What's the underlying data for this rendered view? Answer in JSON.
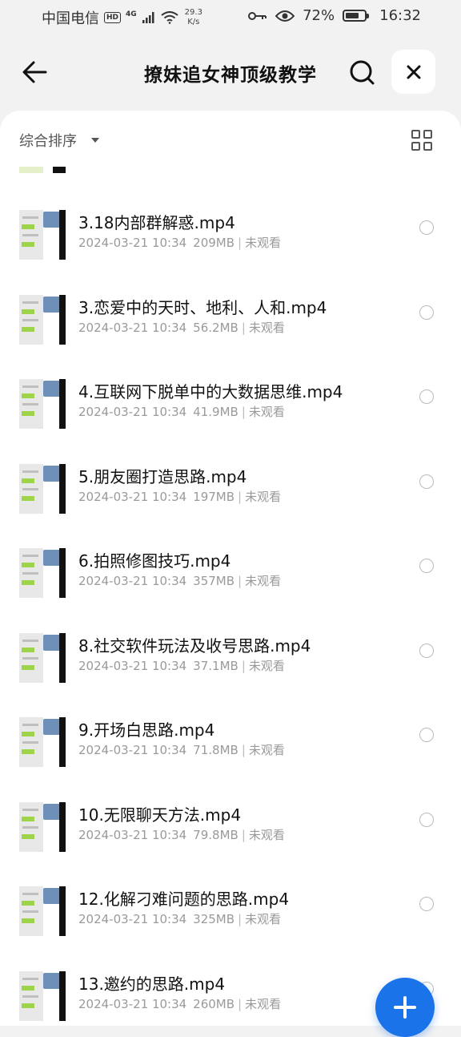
{
  "status_bar": {
    "carrier": "中国电信",
    "hd": "HD",
    "network": "4G",
    "speed_value": "29.3",
    "speed_unit": "K/s",
    "battery": "72%",
    "battery_level": 0.72,
    "time": "16:32"
  },
  "header": {
    "title": "撩妹追女神顶级教学"
  },
  "toolbar": {
    "sort_label": "综合排序"
  },
  "files": [
    {
      "name": "3.18内部群解惑.mp4",
      "date": "2024-03-21 10:34",
      "size": "209MB",
      "status": "未观看"
    },
    {
      "name": "3.恋爱中的天时、地利、人和.mp4",
      "date": "2024-03-21 10:34",
      "size": "56.2MB",
      "status": "未观看"
    },
    {
      "name": "4.互联网下脱单中的大数据思维.mp4",
      "date": "2024-03-21 10:34",
      "size": "41.9MB",
      "status": "未观看"
    },
    {
      "name": "5.朋友圈打造思路.mp4",
      "date": "2024-03-21 10:34",
      "size": "197MB",
      "status": "未观看"
    },
    {
      "name": "6.拍照修图技巧.mp4",
      "date": "2024-03-21 10:34",
      "size": "357MB",
      "status": "未观看"
    },
    {
      "name": "8.社交软件玩法及收号思路.mp4",
      "date": "2024-03-21 10:34",
      "size": "37.1MB",
      "status": "未观看"
    },
    {
      "name": "9.开场白思路.mp4",
      "date": "2024-03-21 10:34",
      "size": "71.8MB",
      "status": "未观看"
    },
    {
      "name": "10.无限聊天方法.mp4",
      "date": "2024-03-21 10:34",
      "size": "79.8MB",
      "status": "未观看"
    },
    {
      "name": "12.化解刁难问题的思路.mp4",
      "date": "2024-03-21 10:34",
      "size": "325MB",
      "status": "未观看"
    },
    {
      "name": "13.邀约的思路.mp4",
      "date": "2024-03-21 10:34",
      "size": "260MB",
      "status": "未观看"
    }
  ],
  "icons": {
    "back": "arrow-left-icon",
    "search": "search-icon",
    "close": "close-icon",
    "sort_caret": "caret-down-icon",
    "grid": "grid-view-icon",
    "fab": "plus-icon"
  },
  "colors": {
    "accent": "#1a73e8",
    "background": "#f2f2f2",
    "card": "#ffffff"
  }
}
